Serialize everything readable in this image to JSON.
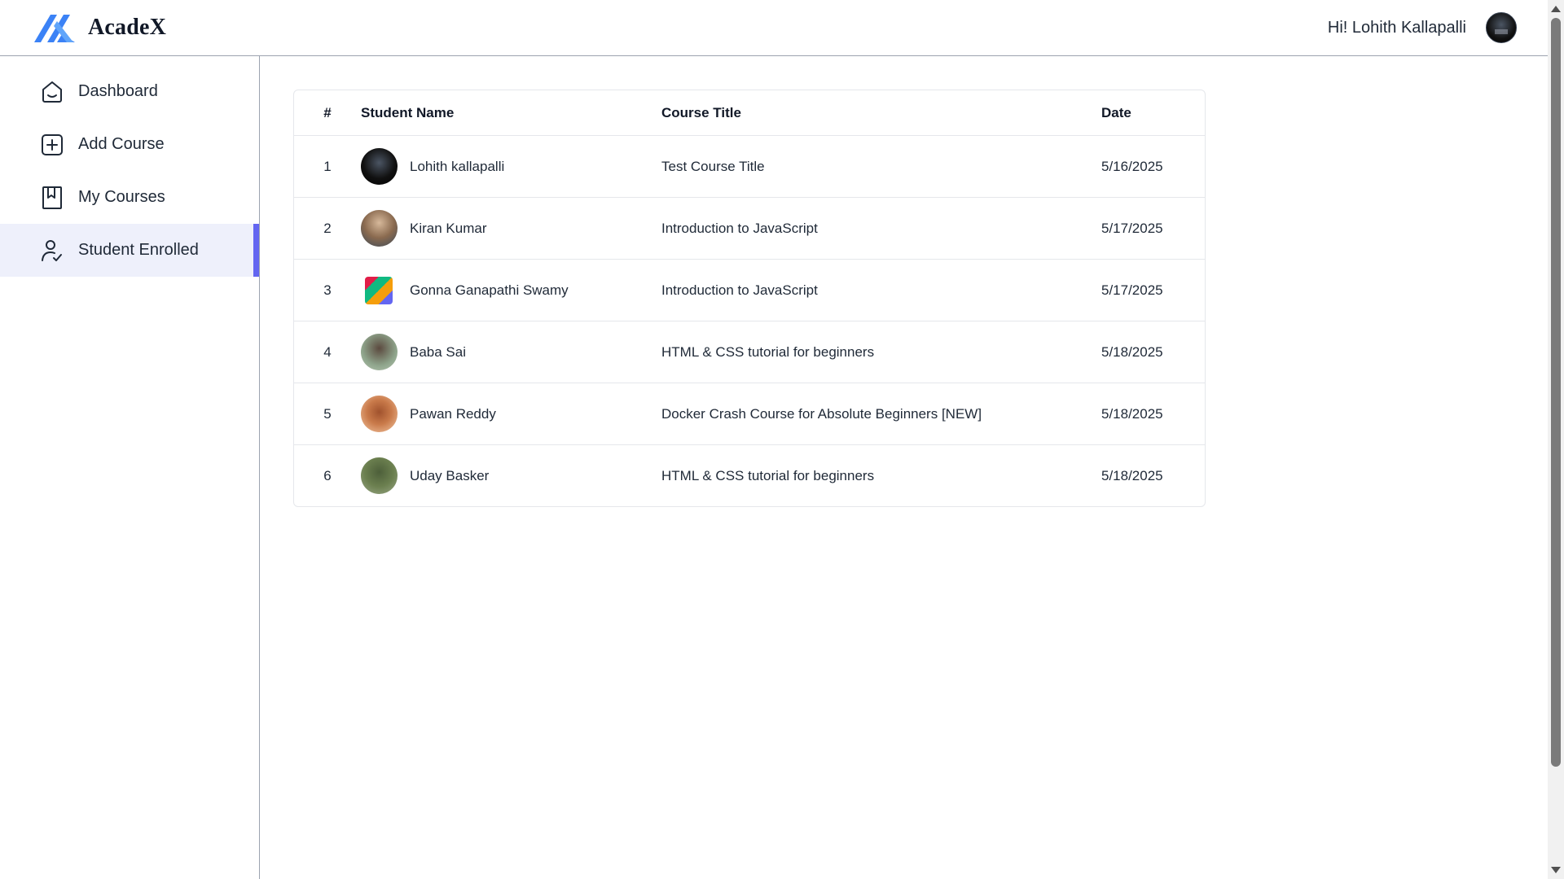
{
  "header": {
    "brand_name": "AcadeX",
    "greeting": "Hi! Lohith Kallapalli"
  },
  "sidebar": {
    "items": [
      {
        "label": "Dashboard",
        "icon": "home-icon"
      },
      {
        "label": "Add Course",
        "icon": "add-icon"
      },
      {
        "label": "My Courses",
        "icon": "bookmark-icon"
      },
      {
        "label": "Student Enrolled",
        "icon": "person-check-icon",
        "active": true
      }
    ]
  },
  "table": {
    "headers": [
      "#",
      "Student Name",
      "Course Title",
      "Date"
    ],
    "rows": [
      {
        "num": "1",
        "name": "Lohith kallapalli",
        "course": "Test Course Title",
        "date": "5/16/2025"
      },
      {
        "num": "2",
        "name": "Kiran Kumar",
        "course": "Introduction to JavaScript",
        "date": "5/17/2025"
      },
      {
        "num": "3",
        "name": "Gonna Ganapathi Swamy",
        "course": "Introduction to JavaScript",
        "date": "5/17/2025"
      },
      {
        "num": "4",
        "name": "Baba Sai",
        "course": "HTML & CSS tutorial for beginners",
        "date": "5/18/2025"
      },
      {
        "num": "5",
        "name": "Pawan Reddy",
        "course": "Docker Crash Course for Absolute Beginners [NEW]",
        "date": "5/18/2025"
      },
      {
        "num": "6",
        "name": "Uday Basker",
        "course": "HTML & CSS tutorial for beginners",
        "date": "5/18/2025"
      }
    ]
  },
  "colors": {
    "accent": "#6366f1",
    "active_bg": "#eef0fb",
    "logo_blue": "#3b82f6"
  }
}
